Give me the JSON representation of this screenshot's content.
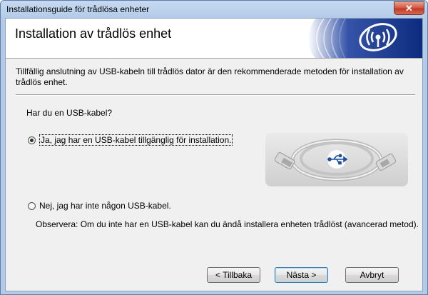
{
  "window": {
    "title": "Installationsguide för trådlösa enheter",
    "close_label": "✕"
  },
  "header": {
    "title": "Installation av trådlös enhet",
    "logo_icon": "wireless-signal-icon"
  },
  "intro_text": "Tillfällig anslutning av USB-kabeln till trådlös dator är den rekommenderade metoden för installation av trådlös enhet.",
  "question": "Har du en USB-kabel?",
  "options": [
    {
      "label": "Ja, jag har en USB-kabel tillgänglig för installation.",
      "selected": true
    },
    {
      "label": "Nej, jag har inte någon USB-kabel.",
      "selected": false
    }
  ],
  "note": "Observera: Om du inte har en USB-kabel kan du ändå installera enheten trådlöst (avancerad metod).",
  "illustration": {
    "icon": "usb-cable-icon"
  },
  "buttons": {
    "back": "< Tillbaka",
    "next": "Nästa >",
    "cancel": "Avbryt"
  },
  "colors": {
    "header_accent": "#1b3a8c",
    "window_frame": "#b4cbe8"
  }
}
